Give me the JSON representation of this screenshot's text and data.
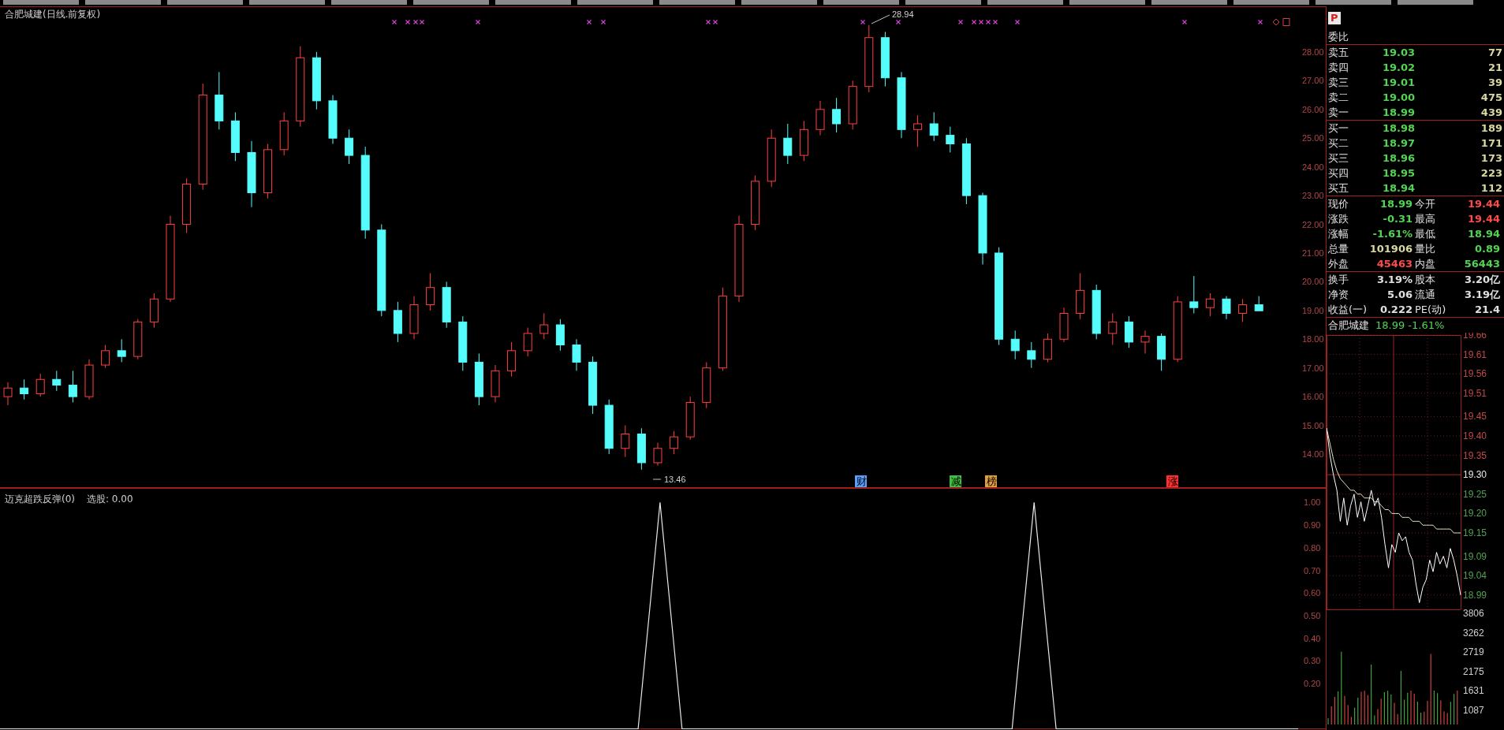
{
  "main_chart": {
    "title": "合肥城建(日线.前复权)",
    "chart_data": {
      "type": "candlestick",
      "categories": [
        null,
        null,
        null,
        null,
        null,
        null,
        null,
        null,
        null,
        null,
        null,
        null,
        null,
        null,
        null,
        null,
        null,
        null,
        null,
        null,
        null,
        null,
        null,
        null,
        null,
        null,
        null,
        null,
        null,
        null,
        null,
        null,
        null,
        null,
        null,
        null,
        null,
        null,
        null,
        null,
        null,
        null,
        null,
        null,
        null,
        null,
        null,
        null,
        null,
        null,
        null,
        null,
        null,
        null,
        null,
        null,
        null,
        null,
        null,
        null,
        null,
        null,
        null,
        null,
        null,
        null,
        null,
        null,
        null,
        null,
        null,
        null,
        null,
        null,
        null,
        null,
        null,
        null
      ],
      "ohlc": [
        [
          16.0,
          16.5,
          15.7,
          16.3
        ],
        [
          16.3,
          16.6,
          15.9,
          16.1
        ],
        [
          16.1,
          16.8,
          16.0,
          16.6
        ],
        [
          16.6,
          16.9,
          16.2,
          16.4
        ],
        [
          16.4,
          16.9,
          15.8,
          16.0
        ],
        [
          16.0,
          17.3,
          15.9,
          17.1
        ],
        [
          17.1,
          17.8,
          17.0,
          17.6
        ],
        [
          17.6,
          18.0,
          17.2,
          17.4
        ],
        [
          17.4,
          18.7,
          17.3,
          18.6
        ],
        [
          18.6,
          19.6,
          18.4,
          19.4
        ],
        [
          19.4,
          22.3,
          19.3,
          22.0
        ],
        [
          22.0,
          23.6,
          21.7,
          23.4
        ],
        [
          23.4,
          26.9,
          23.2,
          26.5
        ],
        [
          26.5,
          27.3,
          25.3,
          25.6
        ],
        [
          25.6,
          25.9,
          24.2,
          24.5
        ],
        [
          24.5,
          24.9,
          22.6,
          23.1
        ],
        [
          23.1,
          24.8,
          22.9,
          24.6
        ],
        [
          24.6,
          25.9,
          24.4,
          25.6
        ],
        [
          25.6,
          28.2,
          25.4,
          27.8
        ],
        [
          27.8,
          28.0,
          26.0,
          26.3
        ],
        [
          26.3,
          26.5,
          24.8,
          25.0
        ],
        [
          25.0,
          25.3,
          24.1,
          24.4
        ],
        [
          24.4,
          24.7,
          21.5,
          21.8
        ],
        [
          21.8,
          22.0,
          18.8,
          19.0
        ],
        [
          19.0,
          19.3,
          17.9,
          18.2
        ],
        [
          18.2,
          19.5,
          18.0,
          19.2
        ],
        [
          19.2,
          20.3,
          19.0,
          19.8
        ],
        [
          19.8,
          20.0,
          18.4,
          18.6
        ],
        [
          18.6,
          18.8,
          16.9,
          17.2
        ],
        [
          17.2,
          17.5,
          15.7,
          16.0
        ],
        [
          16.0,
          17.1,
          15.8,
          16.9
        ],
        [
          16.9,
          17.9,
          16.7,
          17.6
        ],
        [
          17.6,
          18.4,
          17.4,
          18.2
        ],
        [
          18.2,
          18.9,
          18.0,
          18.5
        ],
        [
          18.5,
          18.7,
          17.6,
          17.8
        ],
        [
          17.8,
          18.0,
          16.9,
          17.2
        ],
        [
          17.2,
          17.4,
          15.4,
          15.7
        ],
        [
          15.7,
          15.9,
          14.0,
          14.2
        ],
        [
          14.2,
          15.0,
          13.9,
          14.7
        ],
        [
          14.7,
          14.9,
          13.46,
          13.7
        ],
        [
          13.7,
          14.4,
          13.6,
          14.2
        ],
        [
          14.2,
          14.8,
          14.0,
          14.6
        ],
        [
          14.6,
          16.0,
          14.5,
          15.8
        ],
        [
          15.8,
          17.2,
          15.6,
          17.0
        ],
        [
          17.0,
          19.8,
          16.9,
          19.5
        ],
        [
          19.5,
          22.3,
          19.3,
          22.0
        ],
        [
          22.0,
          23.7,
          21.8,
          23.5
        ],
        [
          23.5,
          25.3,
          23.3,
          25.0
        ],
        [
          25.0,
          25.5,
          24.1,
          24.4
        ],
        [
          24.4,
          25.6,
          24.2,
          25.3
        ],
        [
          25.3,
          26.3,
          25.1,
          26.0
        ],
        [
          26.0,
          26.4,
          25.2,
          25.5
        ],
        [
          25.5,
          27.0,
          25.3,
          26.8
        ],
        [
          26.8,
          28.94,
          26.6,
          28.5
        ],
        [
          28.5,
          28.7,
          26.8,
          27.1
        ],
        [
          27.1,
          27.3,
          25.0,
          25.3
        ],
        [
          25.3,
          25.8,
          24.7,
          25.5
        ],
        [
          25.5,
          25.9,
          24.9,
          25.1
        ],
        [
          25.1,
          25.4,
          24.5,
          24.8
        ],
        [
          24.8,
          25.0,
          22.7,
          23.0
        ],
        [
          23.0,
          23.1,
          20.6,
          21.0
        ],
        [
          21.0,
          21.2,
          17.8,
          18.0
        ],
        [
          18.0,
          18.3,
          17.3,
          17.6
        ],
        [
          17.6,
          17.9,
          17.0,
          17.3
        ],
        [
          17.3,
          18.2,
          17.2,
          18.0
        ],
        [
          18.0,
          19.1,
          17.9,
          18.9
        ],
        [
          18.9,
          20.3,
          18.7,
          19.7
        ],
        [
          19.7,
          19.9,
          18.0,
          18.2
        ],
        [
          18.2,
          18.9,
          17.8,
          18.6
        ],
        [
          18.6,
          18.8,
          17.7,
          17.9
        ],
        [
          17.9,
          18.3,
          17.5,
          18.1
        ],
        [
          18.1,
          18.2,
          16.9,
          17.3
        ],
        [
          17.3,
          19.5,
          17.2,
          19.3
        ],
        [
          19.3,
          20.2,
          18.9,
          19.1
        ],
        [
          19.1,
          19.6,
          18.8,
          19.4
        ],
        [
          19.4,
          19.5,
          18.7,
          18.9
        ],
        [
          18.9,
          19.4,
          18.6,
          19.2
        ],
        [
          19.2,
          19.5,
          18.99,
          18.99
        ]
      ],
      "ylim": [
        12.82,
        29.59
      ],
      "yticks": [
        {
          "value": 28,
          "label": "28.00"
        },
        {
          "value": 27,
          "label": "27.00"
        },
        {
          "value": 26,
          "label": "26.00"
        },
        {
          "value": 25,
          "label": "25.00"
        },
        {
          "value": 24,
          "label": "24.00"
        },
        {
          "value": 23,
          "label": "23.00"
        },
        {
          "value": 22,
          "label": "22.00"
        },
        {
          "value": 21,
          "label": "21.00"
        },
        {
          "value": 20,
          "label": "20.00"
        },
        {
          "value": 19,
          "label": "19.00"
        },
        {
          "value": 18,
          "label": "18.00"
        },
        {
          "value": 17,
          "label": "17.00"
        },
        {
          "value": 16,
          "label": "16.00"
        },
        {
          "value": 15,
          "label": "15.00"
        },
        {
          "value": 14,
          "label": "14.00"
        }
      ]
    },
    "high_label": "28.94",
    "low_label": "13.46",
    "event_tags": [
      {
        "text": "财",
        "color": "#5aa0ff"
      },
      {
        "text": "减",
        "color": "#40c040"
      },
      {
        "text": "榜",
        "color": "#e0a040"
      },
      {
        "text": "涨",
        "color": "#ff3030"
      }
    ]
  },
  "indicator": {
    "name": "迈克超跌反弹(0)",
    "reading": "选股: 0.00",
    "chart_data": {
      "type": "line",
      "categories": [
        null,
        null,
        null,
        null,
        null,
        null,
        null,
        null,
        null,
        null,
        null,
        null,
        null,
        null,
        null,
        null,
        null,
        null,
        null,
        null,
        null,
        null,
        null,
        null,
        null,
        null,
        null,
        null,
        null,
        null,
        null,
        null,
        null,
        null,
        null,
        null,
        null,
        null,
        null,
        null,
        null,
        null,
        null,
        null,
        null,
        null,
        null,
        null,
        null,
        null,
        null,
        null,
        null,
        null,
        null,
        null,
        null,
        null,
        null,
        null
      ],
      "series": [
        {
          "color": "#e8e8e8",
          "values": [
            0,
            0,
            0,
            0,
            0,
            0,
            0,
            0,
            0,
            0,
            0,
            0,
            0,
            0,
            0,
            0,
            0,
            0,
            0,
            0,
            0,
            0,
            0,
            0,
            0,
            0,
            0,
            0,
            0,
            0,
            1,
            0,
            0,
            0,
            0,
            0,
            0,
            0,
            0,
            0,
            0,
            0,
            0,
            0,
            0,
            0,
            0,
            1,
            0,
            0,
            0,
            0,
            0,
            0,
            0,
            0,
            0,
            0,
            0,
            0
          ]
        }
      ],
      "ylim": [
        0,
        1.0625
      ],
      "yticks": [
        {
          "value": 1,
          "label": "1.00"
        },
        {
          "value": 0.9,
          "label": "0.90"
        },
        {
          "value": 0.8,
          "label": "0.80"
        },
        {
          "value": 0.7,
          "label": "0.70"
        },
        {
          "value": 0.6,
          "label": "0.60"
        },
        {
          "value": 0.5,
          "label": "0.50"
        },
        {
          "value": 0.4,
          "label": "0.40"
        },
        {
          "value": 0.3,
          "label": "0.30"
        },
        {
          "value": 0.2,
          "label": "0.20"
        }
      ]
    }
  },
  "quote_panel": {
    "badge": "P",
    "ratio_label": "委比",
    "asks": [
      {
        "label": "卖五",
        "price": "19.03",
        "volume": "77"
      },
      {
        "label": "卖四",
        "price": "19.02",
        "volume": "21"
      },
      {
        "label": "卖三",
        "price": "19.01",
        "volume": "39"
      },
      {
        "label": "卖二",
        "price": "19.00",
        "volume": "475"
      },
      {
        "label": "卖一",
        "price": "18.99",
        "volume": "439"
      }
    ],
    "bids": [
      {
        "label": "买一",
        "price": "18.98",
        "volume": "189"
      },
      {
        "label": "买二",
        "price": "18.97",
        "volume": "171"
      },
      {
        "label": "买三",
        "price": "18.96",
        "volume": "173"
      },
      {
        "label": "买四",
        "price": "18.95",
        "volume": "223"
      },
      {
        "label": "买五",
        "price": "18.94",
        "volume": "112"
      }
    ],
    "stats": [
      {
        "label": "现价",
        "value": "18.99",
        "color": "#52d452"
      },
      {
        "label": "今开",
        "value": "19.44",
        "color": "#ff4a4a"
      },
      {
        "label": "涨跌",
        "value": "-0.31",
        "color": "#52d452"
      },
      {
        "label": "最高",
        "value": "19.44",
        "color": "#ff4a4a"
      },
      {
        "label": "涨幅",
        "value": "-1.61%",
        "color": "#52d452"
      },
      {
        "label": "最低",
        "value": "18.94",
        "color": "#52d452"
      },
      {
        "label": "总量",
        "value": "101906",
        "color": "#d8d8a0"
      },
      {
        "label": "量比",
        "value": "0.89",
        "color": "#52d452"
      },
      {
        "label": "外盘",
        "value": "45463",
        "color": "#ff4a4a"
      },
      {
        "label": "内盘",
        "value": "56443",
        "color": "#52d452"
      }
    ],
    "fundamentals": [
      {
        "label": "换手",
        "value": "3.19%"
      },
      {
        "label": "股本",
        "value": "3.20亿"
      },
      {
        "label": "净资",
        "value": "5.06"
      },
      {
        "label": "流通",
        "value": "3.19亿"
      },
      {
        "label": "收益(一)",
        "value": "0.222"
      },
      {
        "label": "PE(动)",
        "value": "21.4"
      }
    ]
  },
  "intraday": {
    "name": "合肥城建",
    "quote": "18.99 -1.61%",
    "chart_data": {
      "type": "line",
      "grid": true,
      "series": [
        {
          "color": "#ffffff",
          "values": [
            19.42,
            19.35,
            19.3,
            19.26,
            19.18,
            19.24,
            19.17,
            19.22,
            19.25,
            19.19,
            19.23,
            19.18,
            19.22,
            19.26,
            19.22,
            19.24,
            19.19,
            19.12,
            19.06,
            19.12,
            19.1,
            19.15,
            19.13,
            19.14,
            19.1,
            19.08,
            19.02,
            18.97,
            19.01,
            19.03,
            19.08,
            19.05,
            19.1,
            19.07,
            19.09,
            19.06,
            19.11,
            19.08,
            19.04,
            18.99
          ]
        },
        {
          "color": "#e0e0c0",
          "values": [
            19.42,
            19.38,
            19.34,
            19.31,
            19.29,
            19.28,
            19.27,
            19.26,
            19.26,
            19.25,
            19.25,
            19.24,
            19.24,
            19.24,
            19.23,
            19.23,
            19.22,
            19.21,
            19.21,
            19.2,
            19.2,
            19.2,
            19.19,
            19.19,
            19.19,
            19.18,
            19.18,
            19.18,
            19.17,
            19.17,
            19.17,
            19.17,
            19.16,
            19.16,
            19.16,
            19.16,
            19.16,
            19.15,
            19.15,
            19.15
          ]
        }
      ],
      "ylim": [
        18.955,
        19.66
      ],
      "yticks": [
        {
          "value": 19.66,
          "label": "19.66"
        },
        {
          "value": 19.61,
          "label": "19.61"
        },
        {
          "value": 19.56,
          "label": "19.56"
        },
        {
          "value": 19.51,
          "label": "19.51"
        },
        {
          "value": 19.45,
          "label": "19.45"
        },
        {
          "value": 19.4,
          "label": "19.40"
        },
        {
          "value": 19.35,
          "label": "19.35"
        },
        {
          "value": 19.3,
          "label": "19.30"
        },
        {
          "value": 19.25,
          "label": "19.25"
        },
        {
          "value": 19.2,
          "label": "19.20"
        },
        {
          "value": 19.15,
          "label": "19.15"
        },
        {
          "value": 19.09,
          "label": "19.09"
        },
        {
          "value": 19.04,
          "label": "19.04"
        },
        {
          "value": 18.99,
          "label": "18.99"
        }
      ]
    },
    "volume_ticks": [
      "3806",
      "3262",
      "2719",
      "2175",
      "1631",
      "1087"
    ]
  }
}
